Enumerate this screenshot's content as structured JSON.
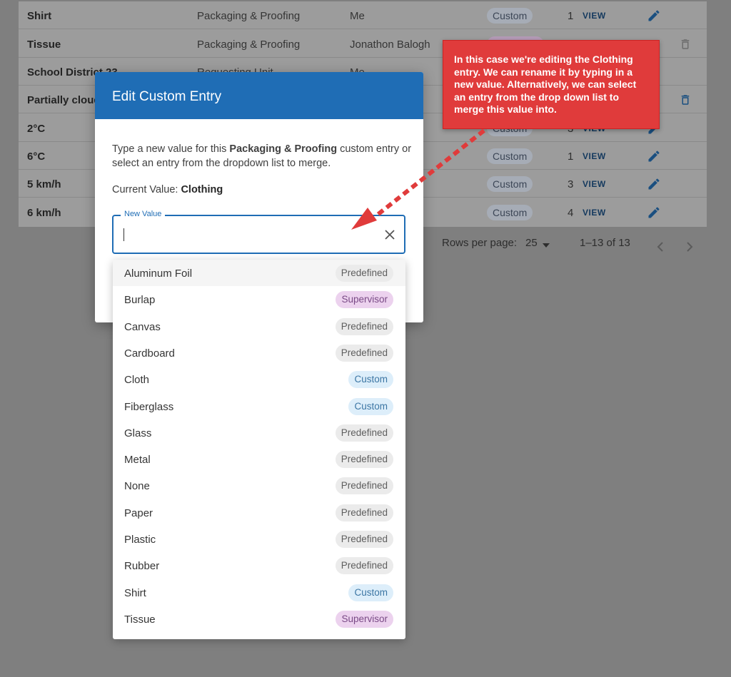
{
  "table": {
    "rows": [
      {
        "name": "Shirt",
        "category": "Packaging & Proofing",
        "by": "Me",
        "status": "Custom",
        "count": "1",
        "view": "VIEW"
      },
      {
        "name": "Tissue",
        "category": "Packaging & Proofing",
        "by": "Jonathon Balogh",
        "status": "Supervisor",
        "count": "",
        "view": ""
      },
      {
        "name": "School District 23",
        "category": "Requesting Unit",
        "by": "Me",
        "status": "",
        "count": "",
        "view": ""
      },
      {
        "name": "Partially cloudy",
        "category": "",
        "by": "",
        "status": "",
        "count": "",
        "view": ""
      },
      {
        "name": "2°C",
        "category": "",
        "by": "",
        "status": "Custom",
        "count": "3",
        "view": "VIEW"
      },
      {
        "name": "6°C",
        "category": "",
        "by": "",
        "status": "Custom",
        "count": "1",
        "view": "VIEW"
      },
      {
        "name": "5 km/h",
        "category": "",
        "by": "",
        "status": "Custom",
        "count": "3",
        "view": "VIEW"
      },
      {
        "name": "6 km/h",
        "category": "",
        "by": "",
        "status": "Custom",
        "count": "4",
        "view": "VIEW"
      }
    ]
  },
  "pagination": {
    "rows_per_page_label": "Rows per page:",
    "rows_per_page_value": "25",
    "range": "1–13 of 13"
  },
  "dialog": {
    "title": "Edit Custom Entry",
    "desc_prefix": "Type a new value for this ",
    "desc_category": "Packaging & Proofing",
    "desc_suffix": " custom entry or select an entry from the dropdown list to merge.",
    "current_label": "Current Value: ",
    "current_value": "Clothing"
  },
  "field": {
    "label": "New Value",
    "value": "",
    "placeholder": ""
  },
  "dropdown": {
    "options": [
      {
        "label": "Aluminum Foil",
        "tag": "Predefined"
      },
      {
        "label": "Burlap",
        "tag": "Supervisor"
      },
      {
        "label": "Canvas",
        "tag": "Predefined"
      },
      {
        "label": "Cardboard",
        "tag": "Predefined"
      },
      {
        "label": "Cloth",
        "tag": "Custom"
      },
      {
        "label": "Fiberglass",
        "tag": "Custom"
      },
      {
        "label": "Glass",
        "tag": "Predefined"
      },
      {
        "label": "Metal",
        "tag": "Predefined"
      },
      {
        "label": "None",
        "tag": "Predefined"
      },
      {
        "label": "Paper",
        "tag": "Predefined"
      },
      {
        "label": "Plastic",
        "tag": "Predefined"
      },
      {
        "label": "Rubber",
        "tag": "Predefined"
      },
      {
        "label": "Shirt",
        "tag": "Custom"
      },
      {
        "label": "Tissue",
        "tag": "Supervisor"
      }
    ]
  },
  "callout": {
    "text": "In this case we're editing the Clothing entry. We can rename it by typing in a new value. Alternatively, we can select an entry from the drop down list to merge this value into."
  },
  "colors": {
    "accent": "#1f6db5",
    "callout": "#e03b3b"
  }
}
